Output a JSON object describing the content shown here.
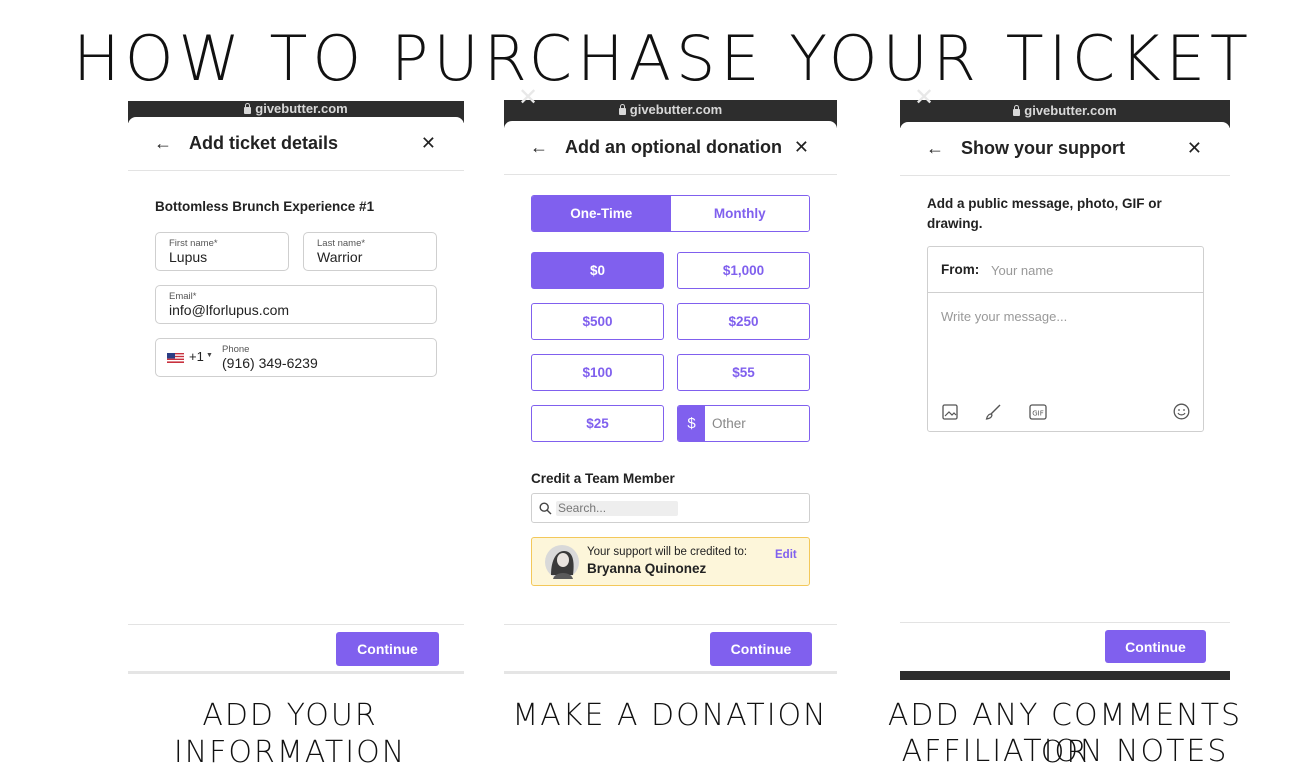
{
  "title": "HOW TO PURCHASE YOUR TICKET",
  "domain_url": "givebutter.com",
  "continue_label": "Continue",
  "panels": {
    "info": {
      "caption": "ADD YOUR INFORMATION",
      "header_title": "Add ticket details",
      "section_title": "Bottomless Brunch Experience #1",
      "first_name_label": "First name*",
      "first_name_value": "Lupus",
      "last_name_label": "Last name*",
      "last_name_value": "Warrior",
      "email_label": "Email*",
      "email_value": "info@lforlupus.com",
      "country_code": "+1",
      "phone_label": "Phone",
      "phone_value": "(916) 349-6239"
    },
    "donation": {
      "caption": "MAKE A DONATION",
      "header_title": "Add an optional donation",
      "frequency": [
        "One-Time",
        "Monthly"
      ],
      "selected_frequency": "One-Time",
      "amounts": [
        "$0",
        "$1,000",
        "$500",
        "$250",
        "$100",
        "$55",
        "$25"
      ],
      "selected_amount": "$0",
      "other_symbol": "$",
      "other_placeholder": "Other",
      "team_title": "Credit a Team Member",
      "search_placeholder": "Search...",
      "credit_text": "Your support will be credited to:",
      "credit_name": "Bryanna Quinonez",
      "edit_label": "Edit"
    },
    "support": {
      "caption_line1": "ADD ANY COMMENTS OR",
      "caption_line2": "AFFILIATION NOTES",
      "header_title": "Show your support",
      "prompt_line1": "Add a public message, photo, GIF or",
      "prompt_line2": "drawing.",
      "from_label": "From:",
      "name_placeholder": "Your name",
      "message_placeholder": "Write your message...",
      "gif_label": "GIF"
    }
  },
  "colors": {
    "accent": "#8060ee",
    "urlbar": "#2d2d2d",
    "credit_bg": "#fdf6da",
    "credit_border": "#f3c85a"
  },
  "icons": [
    "lock-icon",
    "back-arrow-icon",
    "close-icon",
    "us-flag-icon",
    "search-icon",
    "image-icon",
    "brush-icon",
    "gif-icon",
    "emoji-icon",
    "avatar"
  ]
}
